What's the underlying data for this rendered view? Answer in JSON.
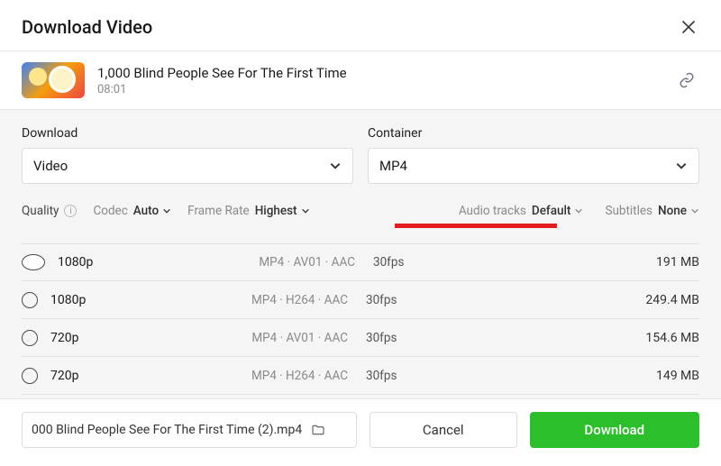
{
  "header": {
    "title": "Download Video"
  },
  "video": {
    "title": "1,000 Blind People See For The First Time",
    "duration": "08:01"
  },
  "selects": {
    "download": {
      "label": "Download",
      "value": "Video"
    },
    "container": {
      "label": "Container",
      "value": "MP4"
    }
  },
  "filters": {
    "quality_label": "Quality",
    "codec_label": "Codec",
    "codec_value": "Auto",
    "framerate_label": "Frame Rate",
    "framerate_value": "Highest",
    "audio_label": "Audio tracks",
    "audio_value": "Default",
    "subtitles_label": "Subtitles",
    "subtitles_value": "None"
  },
  "rows": [
    {
      "selected": true,
      "resolution": "1080p",
      "codec": "MP4 · AV01 · AAC",
      "fps": "30fps",
      "size": "191 MB"
    },
    {
      "selected": false,
      "resolution": "1080p",
      "codec": "MP4 · H264 · AAC",
      "fps": "30fps",
      "size": "249.4 MB"
    },
    {
      "selected": false,
      "resolution": "720p",
      "codec": "MP4 · AV01 · AAC",
      "fps": "30fps",
      "size": "154.6 MB"
    },
    {
      "selected": false,
      "resolution": "720p",
      "codec": "MP4 · H264 · AAC",
      "fps": "30fps",
      "size": "149 MB"
    }
  ],
  "footer": {
    "filename": "000 Blind People See For The First Time (2).mp4",
    "cancel": "Cancel",
    "download": "Download"
  }
}
